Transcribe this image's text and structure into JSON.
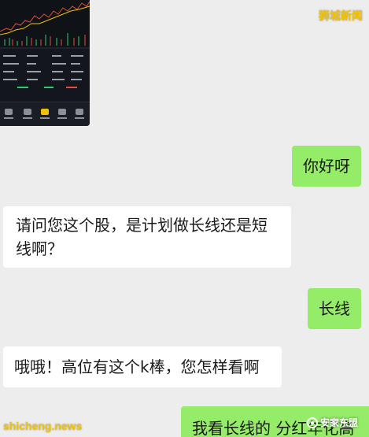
{
  "watermarks": {
    "top_right": "狮城新闻",
    "bottom_left": "shicheng.news",
    "bottom_right": "安家东盟"
  },
  "thumbnail": {
    "icon": "stock-app-screenshot-icon",
    "accent_color": "#f2c200",
    "up_color": "#2ecc71",
    "down_color": "#e74c3c"
  },
  "messages": [
    {
      "side": "out",
      "text": "你好呀"
    },
    {
      "side": "in",
      "text": "请问您这个股，是计划做长线还是短线啊？"
    },
    {
      "side": "out",
      "text": "长线"
    },
    {
      "side": "in",
      "text": "哦哦！高位有这个k棒，您怎样看啊"
    },
    {
      "side": "out",
      "text": "我看长线的 分红年化高"
    }
  ]
}
